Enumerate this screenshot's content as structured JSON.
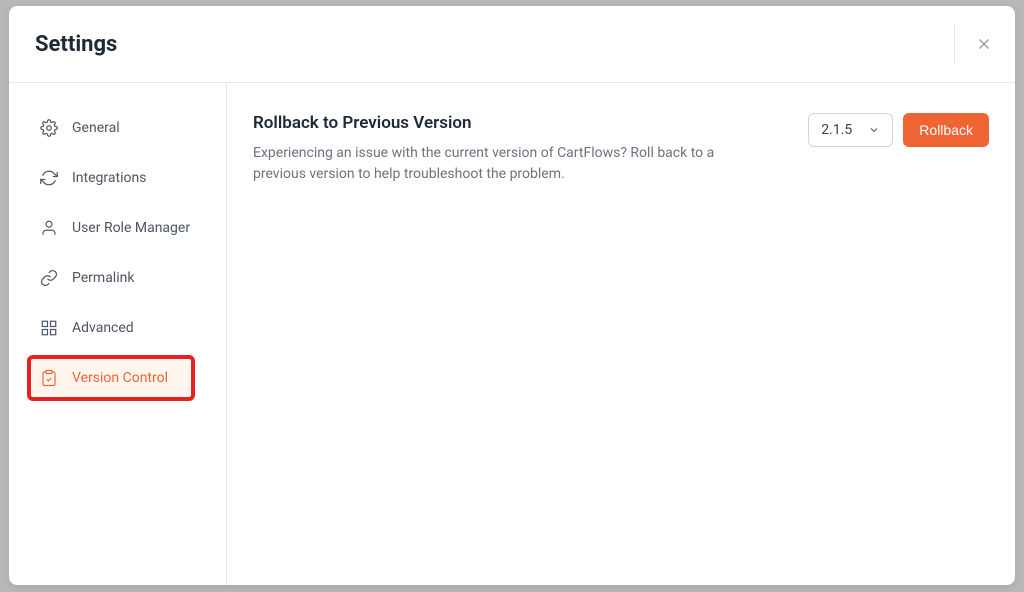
{
  "header": {
    "title": "Settings"
  },
  "sidebar": {
    "items": [
      {
        "label": "General"
      },
      {
        "label": "Integrations"
      },
      {
        "label": "User Role Manager"
      },
      {
        "label": "Permalink"
      },
      {
        "label": "Advanced"
      },
      {
        "label": "Version Control"
      }
    ]
  },
  "content": {
    "title": "Rollback to Previous Version",
    "description": "Experiencing an issue with the current version of CartFlows? Roll back to a previous version to help troubleshoot the problem.",
    "selected_version": "2.1.5",
    "rollback_button": "Rollback"
  }
}
